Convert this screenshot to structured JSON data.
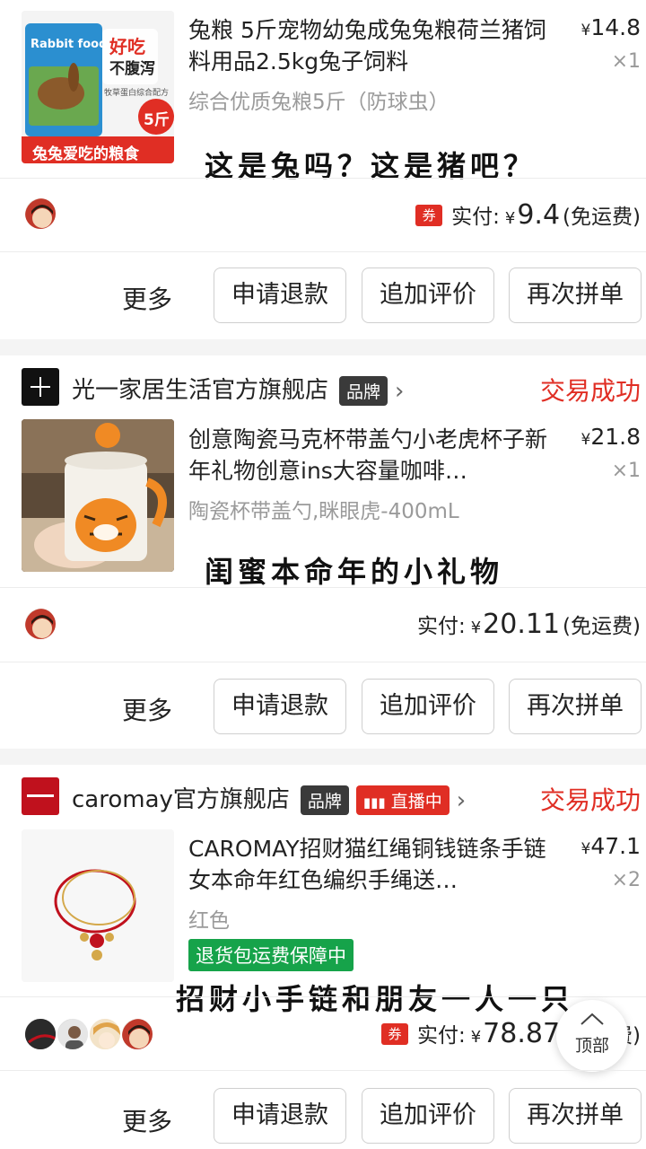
{
  "order1": {
    "title": "兔粮 5斤宠物幼兔成兔兔粮荷兰猪饲料用品2.5kg兔子饲料",
    "price_currency": "¥",
    "price": "14.8",
    "qty": "×1",
    "spec": "综合优质兔粮5斤（防球虫）",
    "caption": "这是兔吗？这是猪吧？",
    "thumb_texts": {
      "brand": "Rabbit food",
      "tag1": "好吃",
      "tag2": "不腹泻",
      "weight": "5斤",
      "bottom": "兔兔爱吃的粮食",
      "sub": "牧草蛋白综合配方"
    },
    "coupon": "券",
    "paid_label": "实付:",
    "paid_currency": "¥",
    "paid_amount": "9.4",
    "shipping": "(免运费)"
  },
  "order2": {
    "store": "光一家居生活官方旗舰店",
    "brand_badge": "品牌",
    "status": "交易成功",
    "title": "创意陶瓷马克杯带盖勺小老虎杯子新年礼物创意ins大容量咖啡…",
    "price_currency": "¥",
    "price": "21.8",
    "qty": "×1",
    "spec": "陶瓷杯带盖勺,眯眼虎-400mL",
    "caption": "闺蜜本命年的小礼物",
    "paid_label": "实付:",
    "paid_currency": "¥",
    "paid_amount": "20.11",
    "shipping": "(免运费)"
  },
  "order3": {
    "store": "caromay官方旗舰店",
    "brand_badge": "品牌",
    "live_badge": "直播中",
    "status": "交易成功",
    "title": "CAROMAY招财猫红绳铜钱链条手链女本命年红色编织手绳送…",
    "price_currency": "¥",
    "price": "47.1",
    "qty": "×2",
    "spec": "红色",
    "guarantee": "退货包运费保障中",
    "caption": "招财小手链和朋友一人一只",
    "coupon": "券",
    "paid_label": "实付:",
    "paid_currency": "¥",
    "paid_amount": "78.87",
    "shipping": "(免运费)"
  },
  "actions": {
    "more": "更多",
    "refund": "申请退款",
    "review": "追加评价",
    "rebuy": "再次拼单"
  },
  "top_button": {
    "label": "顶部"
  },
  "colors": {
    "accent_red": "#e02e24",
    "guarantee_green": "#16a34a",
    "brand_badge": "#3a3a3a"
  }
}
